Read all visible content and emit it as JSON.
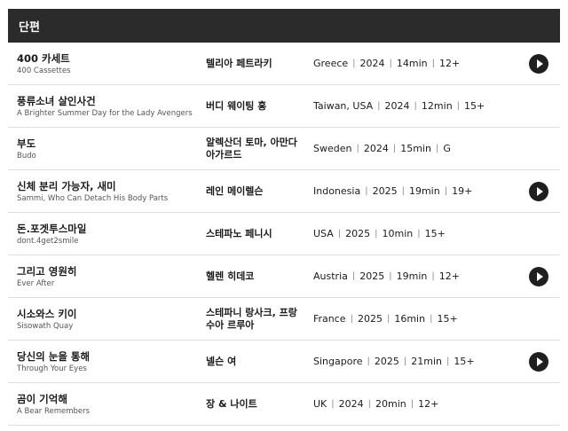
{
  "section": {
    "title": "단편"
  },
  "films": [
    {
      "title_ko": "400 카세트",
      "title_en": "400 Cassettes",
      "director": "텔리아 페트라키",
      "country": "Greece",
      "year": "2024",
      "runtime": "14min",
      "rating": "12+",
      "has_play": true
    },
    {
      "title_ko": "풍류소녀 살인사건",
      "title_en": "A Brighter Summer Day for the Lady Avengers",
      "director": "버디 웨이팅 홍",
      "country": "Taiwan, USA",
      "year": "2024",
      "runtime": "12min",
      "rating": "15+",
      "has_play": false
    },
    {
      "title_ko": "부도",
      "title_en": "Budo",
      "director": "알렉산더 토마, 아만다 아가르드",
      "country": "Sweden",
      "year": "2024",
      "runtime": "15min",
      "rating": "G",
      "has_play": false
    },
    {
      "title_ko": "신체 분리 가능자, 새미",
      "title_en": "Sammi, Who Can Detach His Body Parts",
      "director": "레인 메이렐슨",
      "country": "Indonesia",
      "year": "2025",
      "runtime": "19min",
      "rating": "19+",
      "has_play": true
    },
    {
      "title_ko": "돈.포겟투스마일",
      "title_en": "dont.4get2smile",
      "director": "스테파노 페니시",
      "country": "USA",
      "year": "2025",
      "runtime": "10min",
      "rating": "15+",
      "has_play": false
    },
    {
      "title_ko": "그리고 영원히",
      "title_en": "Ever After",
      "director": "헬렌 히데코",
      "country": "Austria",
      "year": "2025",
      "runtime": "19min",
      "rating": "12+",
      "has_play": true
    },
    {
      "title_ko": "시소와스 키이",
      "title_en": "Sisowath Quay",
      "director": "스테파니 랑사크, 프랑수아 르루아",
      "country": "France",
      "year": "2025",
      "runtime": "16min",
      "rating": "15+",
      "has_play": false
    },
    {
      "title_ko": "당신의 눈을 통해",
      "title_en": "Through Your Eyes",
      "director": "넬슨 여",
      "country": "Singapore",
      "year": "2025",
      "runtime": "21min",
      "rating": "15+",
      "has_play": true
    },
    {
      "title_ko": "곰이 기억해",
      "title_en": "A Bear Remembers",
      "director": "장 & 나이트",
      "country": "UK",
      "year": "2024",
      "runtime": "20min",
      "rating": "12+",
      "has_play": false
    }
  ],
  "icons": {
    "play": "play-icon"
  },
  "colors": {
    "header_bg": "#2b2b2b",
    "play_button": "#1f1f1f",
    "divider": "#dedede"
  }
}
